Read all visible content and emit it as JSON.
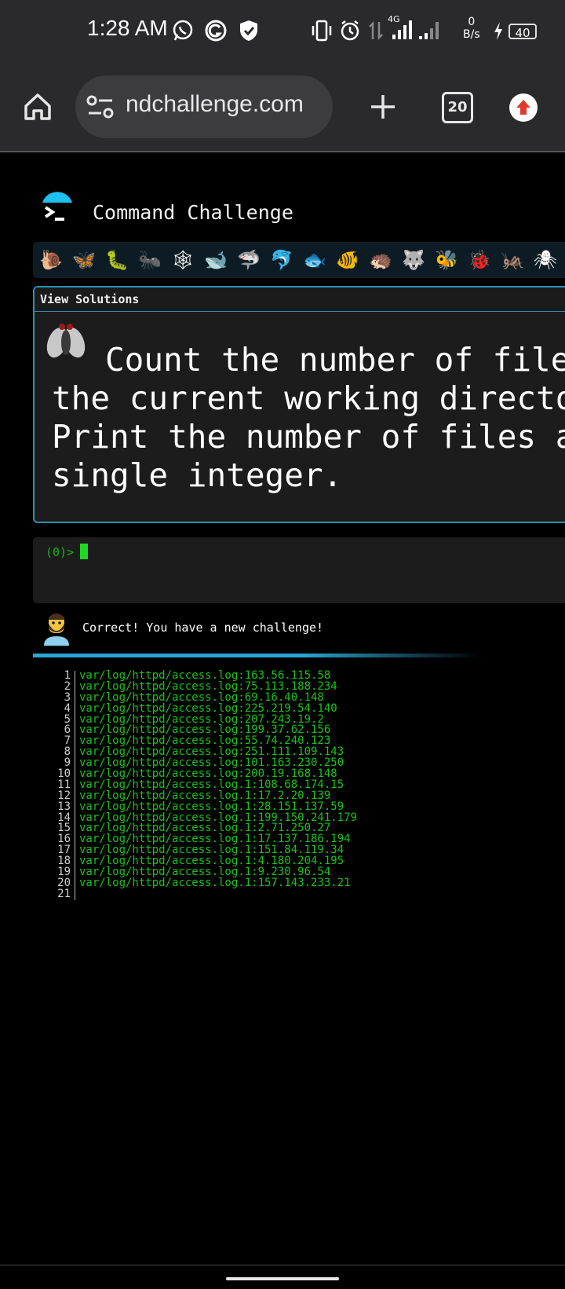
{
  "status_bar": {
    "time": "1:28 AM",
    "network_type": "4G",
    "net_speed_value": "0",
    "net_speed_unit": "B/s",
    "battery": "40"
  },
  "browser": {
    "url": "ndchallenge.com",
    "tab_count": "20"
  },
  "site": {
    "title": "Command Challenge",
    "animals": [
      "🐌",
      "🦋",
      "🐛",
      "🐜",
      "🕸",
      "🐋",
      "🦈",
      "🐬",
      "🐟",
      "🐠",
      "🦔",
      "🐺",
      "🐝",
      "🐞",
      "🦗",
      "🕷"
    ]
  },
  "challenge": {
    "view_solutions_label": "View Solutions",
    "text": "Count the number of files in the current working directory. Print the number of files as a single integer."
  },
  "terminal": {
    "prompt": "(0)>"
  },
  "feedback": {
    "message": "Correct! You have a new challenge!"
  },
  "output": {
    "lines": [
      {
        "n": "1",
        "text": "var/log/httpd/access.log:163.56.115.58"
      },
      {
        "n": "2",
        "text": "var/log/httpd/access.log:75.113.188.234"
      },
      {
        "n": "3",
        "text": "var/log/httpd/access.log:69.16.40.148"
      },
      {
        "n": "4",
        "text": "var/log/httpd/access.log:225.219.54.140"
      },
      {
        "n": "5",
        "text": "var/log/httpd/access.log:207.243.19.2"
      },
      {
        "n": "6",
        "text": "var/log/httpd/access.log:199.37.62.156"
      },
      {
        "n": "7",
        "text": "var/log/httpd/access.log:55.74.240.123"
      },
      {
        "n": "8",
        "text": "var/log/httpd/access.log:251.111.109.143"
      },
      {
        "n": "9",
        "text": "var/log/httpd/access.log:101.163.230.250"
      },
      {
        "n": "10",
        "text": "var/log/httpd/access.log:200.19.168.148"
      },
      {
        "n": "11",
        "text": "var/log/httpd/access.log.1:108.68.174.15"
      },
      {
        "n": "12",
        "text": "var/log/httpd/access.log.1:17.2.20.139"
      },
      {
        "n": "13",
        "text": "var/log/httpd/access.log.1:28.151.137.59"
      },
      {
        "n": "14",
        "text": "var/log/httpd/access.log.1:199.150.241.179"
      },
      {
        "n": "15",
        "text": "var/log/httpd/access.log.1:2.71.250.27"
      },
      {
        "n": "16",
        "text": "var/log/httpd/access.log.1:17.137.186.194"
      },
      {
        "n": "17",
        "text": "var/log/httpd/access.log.1:151.84.119.34"
      },
      {
        "n": "18",
        "text": "var/log/httpd/access.log.1:4.180.204.195"
      },
      {
        "n": "19",
        "text": "var/log/httpd/access.log.1:9.230.96.54"
      },
      {
        "n": "20",
        "text": "var/log/httpd/access.log.1:157.143.233.21"
      },
      {
        "n": "21",
        "text": ""
      }
    ]
  },
  "colors": {
    "accent": "#2aa6d4",
    "terminal_green": "#18c418",
    "panel_bg": "#1c1c1c"
  }
}
